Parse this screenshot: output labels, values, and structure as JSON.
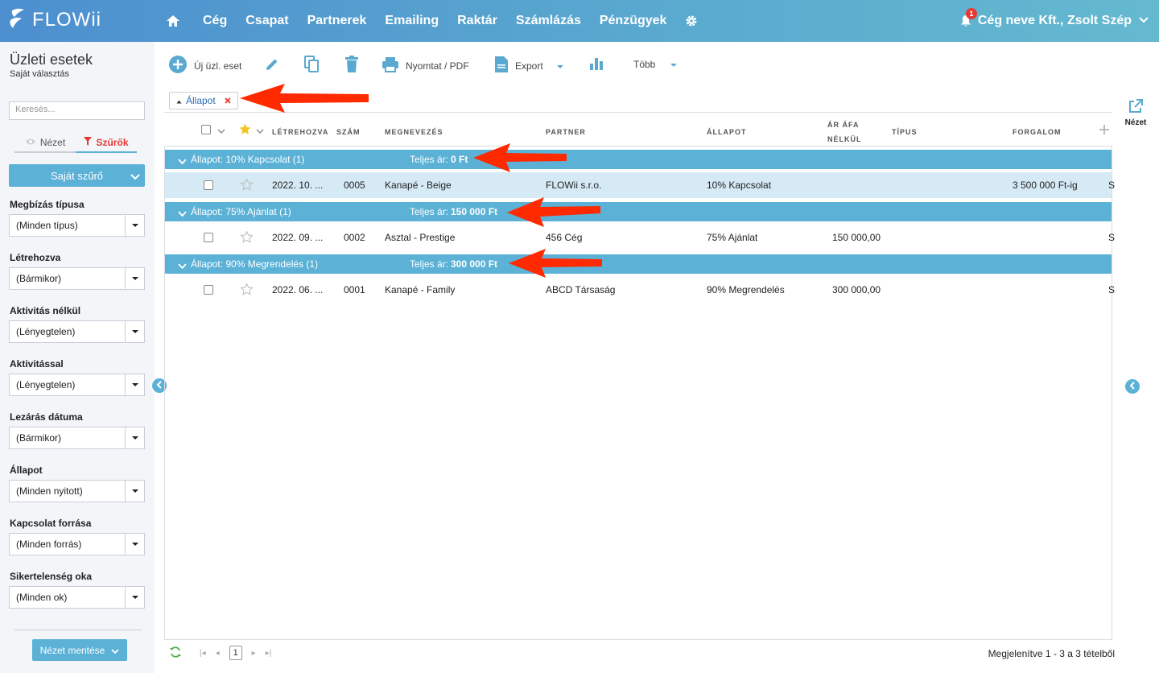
{
  "topbar": {
    "logo": "FLOWii",
    "nav": [
      "Cég",
      "Csapat",
      "Partnerek",
      "Emailing",
      "Raktár",
      "Számlázás",
      "Pénzügyek"
    ],
    "notification_count": "1",
    "user": "Cég neve Kft., Zsolt Szép"
  },
  "page": {
    "title": "Üzleti esetek",
    "subtitle": "Saját választás"
  },
  "toolbar": {
    "new": "Új üzl. eset",
    "print": "Nyomtat / PDF",
    "export": "Export",
    "more": "Több"
  },
  "sidebar": {
    "search_placeholder": "Keresés...",
    "tab_view": "Nézet",
    "tab_filters": "Szűrők",
    "own_filter": "Saját szűrő",
    "filters": [
      {
        "label": "Megbízás típusa",
        "value": "(Minden típus)"
      },
      {
        "label": "Létrehozva",
        "value": "(Bármikor)"
      },
      {
        "label": "Aktivitás nélkül",
        "value": "(Lényegtelen)"
      },
      {
        "label": "Aktivitással",
        "value": "(Lényegtelen)"
      },
      {
        "label": "Lezárás dátuma",
        "value": "(Bármikor)"
      },
      {
        "label": "Állapot",
        "value": "(Minden nyitott)"
      },
      {
        "label": "Kapcsolat forrása",
        "value": "(Minden forrás)"
      },
      {
        "label": "Sikertelenség oka",
        "value": "(Minden ok)"
      }
    ],
    "save_view": "Nézet mentése"
  },
  "grouping_chip": "Állapot",
  "columns": {
    "created": "LÉTREHOZVA",
    "number": "SZÁM",
    "name": "MEGNEVEZÉS",
    "partner": "PARTNER",
    "status": "ÁLLAPOT",
    "price_line1": "ÁR ÁFA",
    "price_line2": "NÉLKÜL",
    "type": "TÍPUS",
    "turnover": "FORGALOM"
  },
  "groups": [
    {
      "label": "Állapot: 10% Kapcsolat (1)",
      "total_label": "Teljes ár:",
      "total": "0 Ft",
      "row": {
        "created": "2022. 10. ...",
        "number": "0005",
        "name": "Kanapé - Beige",
        "partner": "FLOWii s.r.o.",
        "status": "10% Kapcsolat",
        "price": "",
        "turnover": "3 500 000 Ft-ig",
        "extra": "S"
      }
    },
    {
      "label": "Állapot: 75% Ajánlat (1)",
      "total_label": "Teljes ár:",
      "total": "150 000 Ft",
      "row": {
        "created": "2022. 09. ...",
        "number": "0002",
        "name": "Asztal - Prestige",
        "partner": "456 Cég",
        "status": "75% Ajánlat",
        "price": "150 000,00",
        "turnover": "",
        "extra": "S"
      }
    },
    {
      "label": "Állapot: 90% Megrendelés (1)",
      "total_label": "Teljes ár:",
      "total": "300 000 Ft",
      "row": {
        "created": "2022. 06. ...",
        "number": "0001",
        "name": "Kanapé - Family",
        "partner": "ABCD Társaság",
        "status": "90% Megrendelés",
        "price": "300 000,00",
        "turnover": "",
        "extra": "S"
      }
    }
  ],
  "pager": {
    "page": "1",
    "summary": "Megjelenítve 1 - 3 a 3 tételből"
  },
  "right_panel": {
    "view_label": "Nézet"
  },
  "colors": {
    "accent": "#5bb1d6",
    "topbar": "#58a6cf",
    "annotation_arrow": "#ff2a00"
  }
}
